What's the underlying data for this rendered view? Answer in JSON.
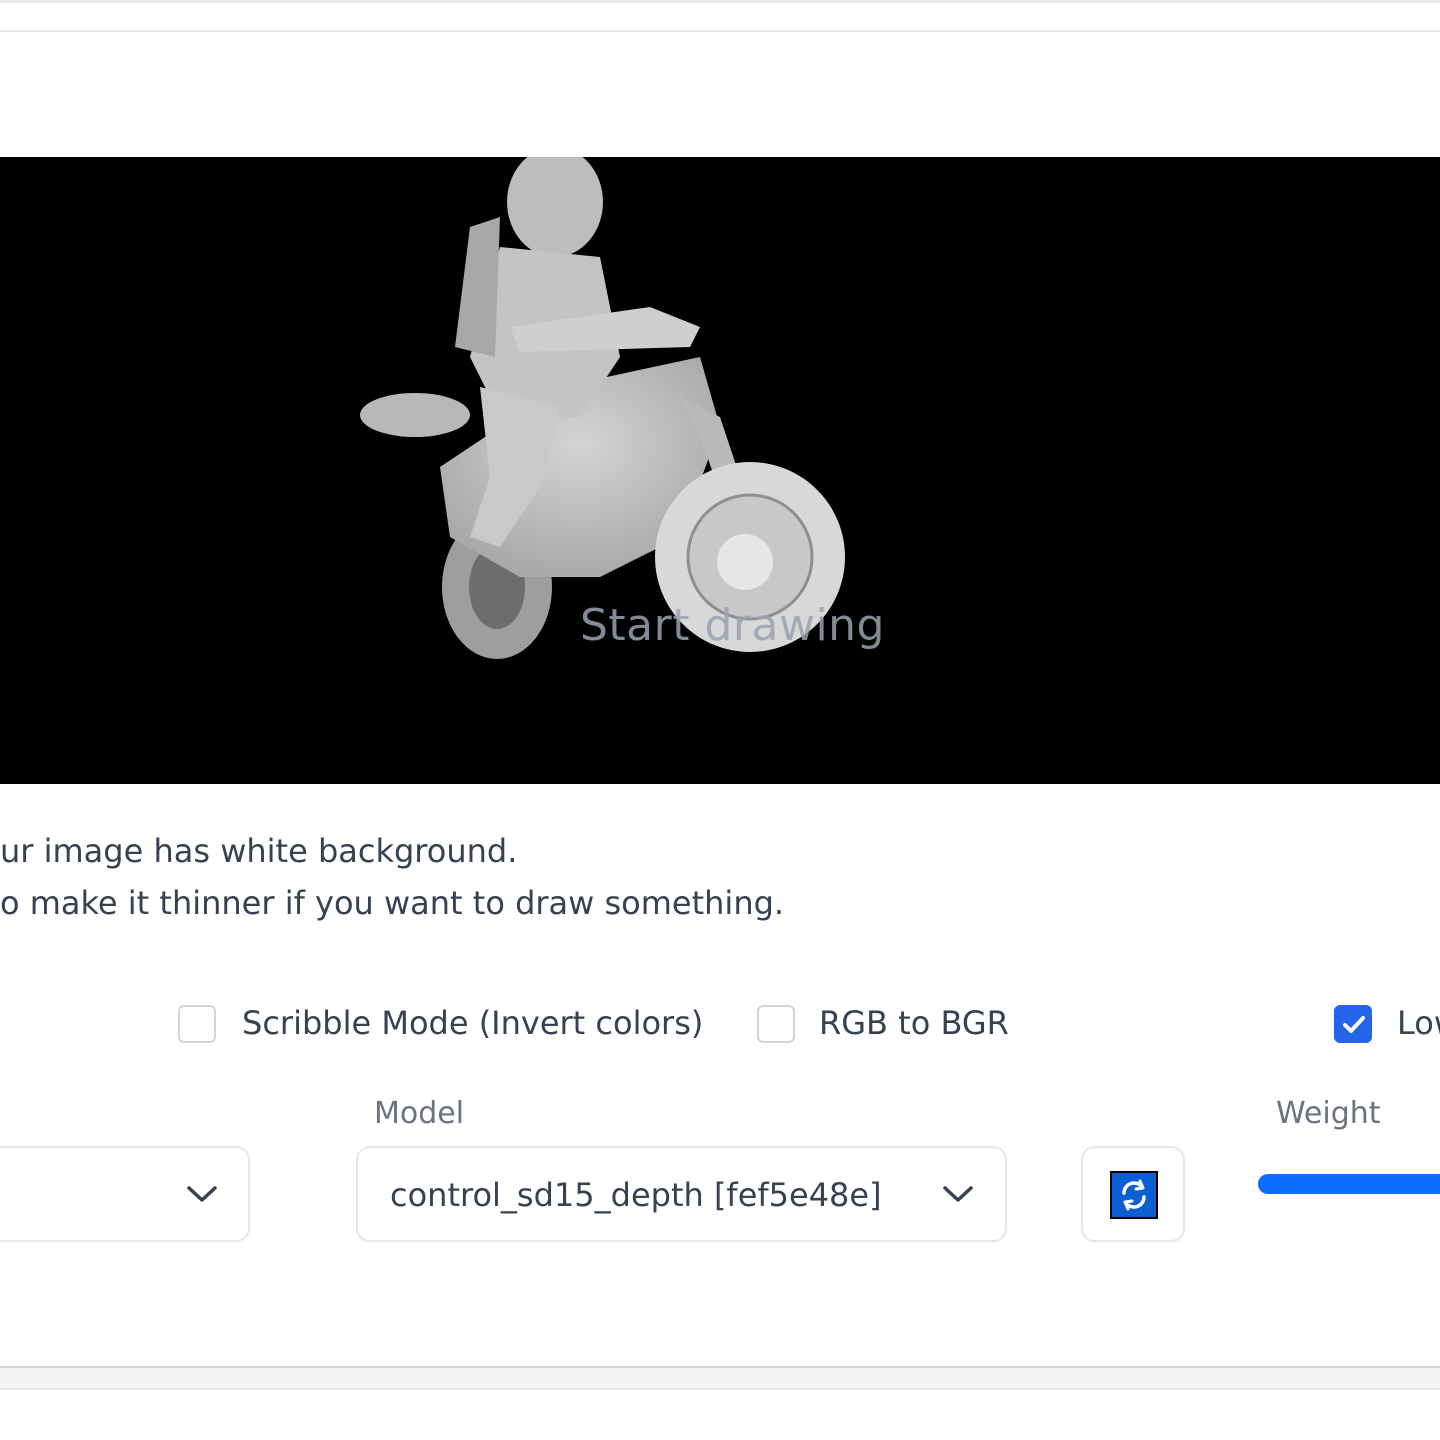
{
  "canvas": {
    "placeholder": "Start drawing"
  },
  "hints": [
    "ur image has white background.",
    "o make it thinner if you want to draw something."
  ],
  "options": {
    "scribble": {
      "label": "Scribble Mode (Invert colors)",
      "checked": false
    },
    "rgb_bgr": {
      "label": "RGB to BGR",
      "checked": false
    },
    "low": {
      "label": "Low",
      "checked": true
    }
  },
  "preprocessor": {
    "value": ""
  },
  "model": {
    "label": "Model",
    "value": "control_sd15_depth [fef5e48e]"
  },
  "refresh": {
    "icon": "refresh-icon"
  },
  "weight": {
    "label": "Weight"
  },
  "colors": {
    "accent": "#2563eb",
    "slider": "#0a6cff",
    "refresh_bg": "#0b5fd0"
  }
}
